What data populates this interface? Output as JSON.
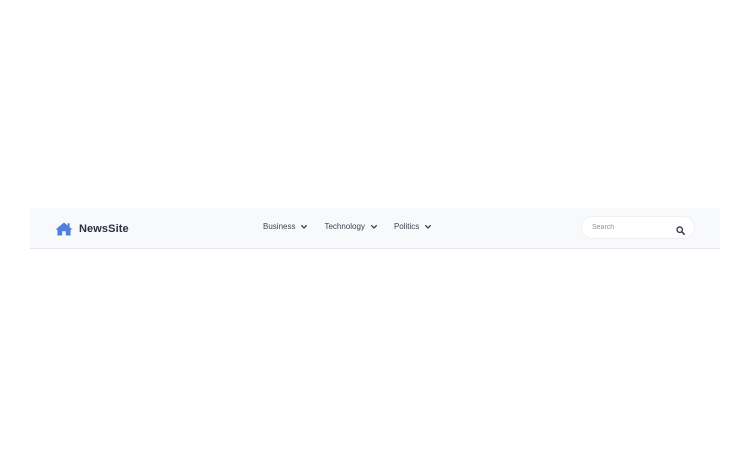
{
  "brand": {
    "name": "NewsSite",
    "icon": "home-icon",
    "color": "#4f7fe0"
  },
  "nav": {
    "items": [
      {
        "label": "Business",
        "icon": "chevron-down-icon"
      },
      {
        "label": "Technology",
        "icon": "chevron-down-icon"
      },
      {
        "label": "Politics",
        "icon": "chevron-down-icon"
      }
    ]
  },
  "search": {
    "placeholder": "Search",
    "value": "",
    "icon": "search-icon"
  }
}
